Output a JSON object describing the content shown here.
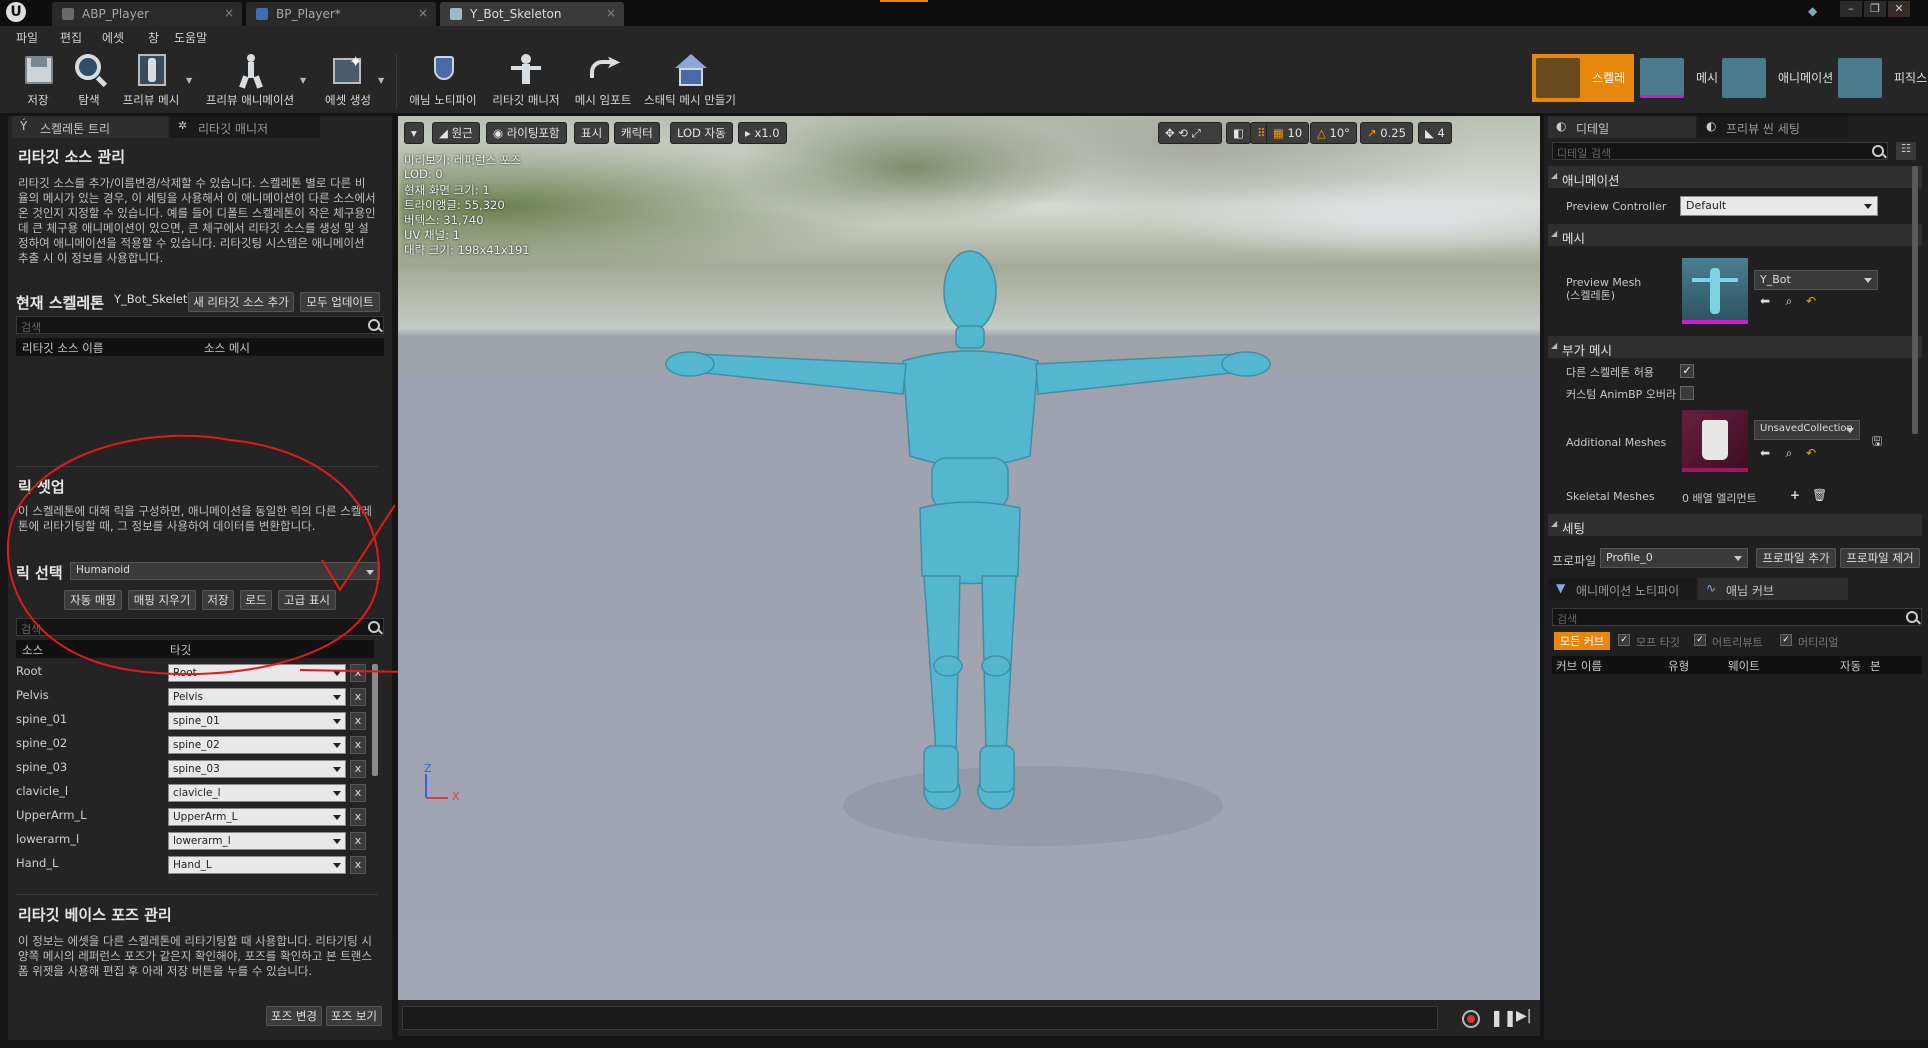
{
  "title_bar": {
    "tabs": [
      {
        "label": "ABP_Player",
        "active": false
      },
      {
        "label": "BP_Player*",
        "active": false
      },
      {
        "label": "Y_Bot_Skeleton",
        "active": true
      }
    ]
  },
  "menu": [
    "파일",
    "편집",
    "에셋",
    "창",
    "도움말"
  ],
  "toolbar": {
    "tools": [
      "저장",
      "탐색",
      "프리뷰 메시",
      "프리뷰 애니메이션",
      "에셋 생성",
      "애님 노티파이",
      "리타깃 매니저",
      "메시 임포트",
      "스태틱 메시 만들기"
    ],
    "modes": [
      "스켈레톤",
      "메시",
      "애니메이션",
      "피직스"
    ],
    "accent": "#e8870e"
  },
  "left_panel": {
    "tabs": [
      "스켈레톤 트리",
      "리타깃 매니저"
    ],
    "source_mgmt": {
      "title": "리타깃 소스 관리",
      "desc": "리타깃 소스를 추가/이름변경/삭제할 수 있습니다. 스켈레톤 별로 다른 비율의 메시가 있는 경우, 이 세팅을 사용해서 이 애니메이션이 다른 소스에서 온 것인지 지정할 수 있습니다. 예를 들어 디폴트 스켈레톤이 작은 체구용인데 큰 체구용 애니메이션이 있으면, 큰 체구에서 리타깃 소스를 생성 및 설정하여 애니메이션을 적용할 수 있습니다. 리타깃팅 시스템은 애니메이션 추출 시 이 정보를 사용합니다.",
      "current_label": "현재 스켈레톤",
      "current_value": "Y_Bot_Skelet",
      "add_button": "새 리타깃 소스 추가",
      "update_button": "모두 업데이트",
      "search_placeholder": "검색",
      "col_name": "리타깃 소스 이름",
      "col_mesh": "소스 메시"
    },
    "rig_setup": {
      "title": "릭 셋업",
      "desc": "이 스켈레톤에 대해 릭을 구성하면, 애니메이션을 동일한 릭의 다른 스켈레톤에 리타기팅할 때, 그 정보를 사용하여 데이터를 변환합니다.",
      "select_label": "릭 선택",
      "select_value": "Humanoid",
      "buttons": [
        "자동 매핑",
        "매핑 지우기",
        "저장",
        "로드",
        "고급 표시"
      ],
      "search_placeholder": "검색",
      "col_source": "소스",
      "col_target": "타깃",
      "rows": [
        {
          "source": "Root",
          "target": "Root"
        },
        {
          "source": "Pelvis",
          "target": "Pelvis"
        },
        {
          "source": "spine_01",
          "target": "spine_01"
        },
        {
          "source": "spine_02",
          "target": "spine_02"
        },
        {
          "source": "spine_03",
          "target": "spine_03"
        },
        {
          "source": "clavicle_l",
          "target": "clavicle_l"
        },
        {
          "source": "UpperArm_L",
          "target": "UpperArm_L"
        },
        {
          "source": "lowerarm_l",
          "target": "lowerarm_l"
        },
        {
          "source": "Hand_L",
          "target": "Hand_L"
        }
      ]
    },
    "base_pose": {
      "title": "리타깃 베이스 포즈 관리",
      "desc": "이 정보는 에셋을 다른 스켈레톤에 리타기팅할 때 사용합니다. 리타기팅 시 양쪽 메시의 레퍼런스 포즈가 같은지 확인해야, 포즈를 확인하고 본 트랜스폼 위젯을 사용해 편집 후 아래 저장 버튼을 누를 수 있습니다.",
      "buttons": [
        "포즈 변경",
        "포즈 보기"
      ]
    }
  },
  "viewport": {
    "buttons": [
      "원근",
      "라이팅포함",
      "표시",
      "캐릭터",
      "LOD 자동",
      "x1.0"
    ],
    "right_values": [
      "10",
      "10°",
      "0.25",
      "4"
    ],
    "info": [
      "미리보기: 레퍼런스 포즈",
      "LOD: 0",
      "현재 화면 크기: 1",
      "트라이앵글: 55,320",
      "버텍스: 31,740",
      "UV 채널: 1",
      "대략 크기: 198x41x191"
    ],
    "axes": {
      "z": "Z",
      "x": "X"
    },
    "character_color": "#52b6cf"
  },
  "right_panel": {
    "tabs": [
      "디테일",
      "프리뷰 씬 세팅"
    ],
    "search_placeholder": "디테일 검색",
    "animation": {
      "title": "애니메이션",
      "preview_controller_label": "Preview Controller",
      "preview_controller_value": "Default"
    },
    "mesh": {
      "title": "메시",
      "preview_mesh_label": "Preview Mesh (스켈레톤)",
      "preview_mesh_value": "Y_Bot"
    },
    "extra_mesh": {
      "title": "부가 메시",
      "allow_diff_label": "다른 스켈레톤 허용",
      "allow_diff_checked": true,
      "custom_animbp_label": "커스텀 AnimBP 오버라",
      "custom_animbp_checked": false,
      "additional_meshes_label": "Additional Meshes",
      "additional_meshes_value": "UnsavedCollection",
      "skeletal_meshes_label": "Skeletal Meshes",
      "skeletal_meshes_value": "0 배열 엘리먼트"
    },
    "settings": {
      "title": "세팅",
      "profile_label": "프로파일",
      "profile_value": "Profile_0",
      "add_profile": "프로파일 추가",
      "remove_profile": "프로파일 제거"
    },
    "bottom_tabs": [
      "애니메이션 노티파이",
      "애님 커브"
    ],
    "curve_search_placeholder": "검색",
    "filters": [
      "모든 커브",
      "모프 타깃",
      "어트리뷰트",
      "머티리얼"
    ],
    "columns": [
      "커브 이름",
      "유형",
      "웨이트",
      "자동",
      "본"
    ]
  }
}
